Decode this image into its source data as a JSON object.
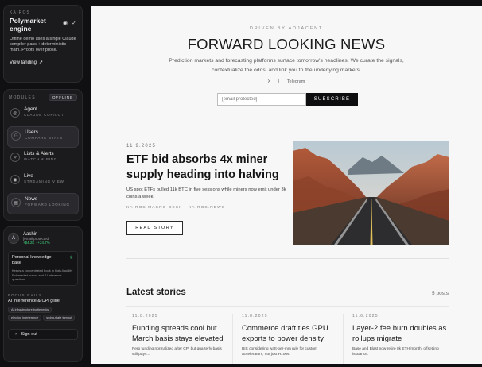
{
  "sidebar": {
    "brand": {
      "eyebrow": "KAIROS",
      "title": "Polymarket engine",
      "description": "Offline demo uses a single Claude compiler pass + deterministic math. Proofs over prose.",
      "view_landing": "View landing",
      "view_landing_icon": "↗"
    },
    "modules": {
      "title": "MODULES",
      "badge": "OFFLINE",
      "items": [
        {
          "label": "Agent",
          "sub": "CLAUDE COPILOT",
          "icon": "agent-icon",
          "glyph": "◎"
        },
        {
          "label": "Users",
          "sub": "COMPARE STATS",
          "icon": "users-icon",
          "glyph": "⚇"
        },
        {
          "label": "Lists & Alerts",
          "sub": "WATCH & PING",
          "icon": "alerts-icon",
          "glyph": "✧"
        },
        {
          "label": "Live",
          "sub": "STREAMING VIEW",
          "icon": "live-icon",
          "glyph": "◉"
        },
        {
          "label": "News",
          "sub": "FORWARD LOOKING",
          "icon": "news-icon",
          "glyph": "▤"
        }
      ]
    },
    "user": {
      "initial": "A",
      "name": "Aashir",
      "email": "[email protected]",
      "pnl": "+$4.2K · +24.7%"
    },
    "knowledge_base": {
      "title": "Personal knowledge base",
      "description": "Keeps a concentrated book in high-liquidity Polymarket macro and AI-inference questions..."
    },
    "rails": {
      "title": "FOCUS RAILS",
      "head": "AI interference & CPI glide",
      "chips": [
        "AI infrastructure bottlenecks",
        "election interference",
        "swing-state turnout"
      ]
    },
    "sign_out": "Sign out"
  },
  "main": {
    "driven": "DRIVEN BY ADJACENT",
    "title": "FORWARD LOOKING NEWS",
    "description": "Prediction markets and forecasting platforms surface tomorrow's headlines. We curate the signals, contextualize the odds, and link you to the underlying markets.",
    "socials": [
      "X",
      "|",
      "Telegram"
    ],
    "subscribe": {
      "placeholder": "[email protected]",
      "button": "SUBSCRIBE"
    },
    "featured": {
      "date": "11.9.2025",
      "title": "ETF bid absorbs 4x miner supply heading into halving",
      "description": "US spot ETFs pulled 11k BTC in five sessions while miners now emit under 3k coins a week.",
      "meta": "KAIROS MACRO DESK · KAIROS.NEWS",
      "read_button": "READ STORY"
    },
    "latest": {
      "title": "Latest stories",
      "count": "5 posts",
      "stories": [
        {
          "date": "11.8.2025",
          "title": "Funding spreads cool but March basis stays elevated",
          "desc": "Perp funding normalized after CPI but quarterly basis still pays..."
        },
        {
          "date": "11.8.2025",
          "title": "Commerce draft ties GPU exports to power density",
          "desc": "BIS considering watt-per-mm rule for custom accelerators, not just H100s."
        },
        {
          "date": "11.6.2025",
          "title": "Layer-2 fee burn doubles as rollups migrate",
          "desc": "Base and Blast now retire 8k ETH/month, offsetting issuance."
        }
      ]
    }
  }
}
